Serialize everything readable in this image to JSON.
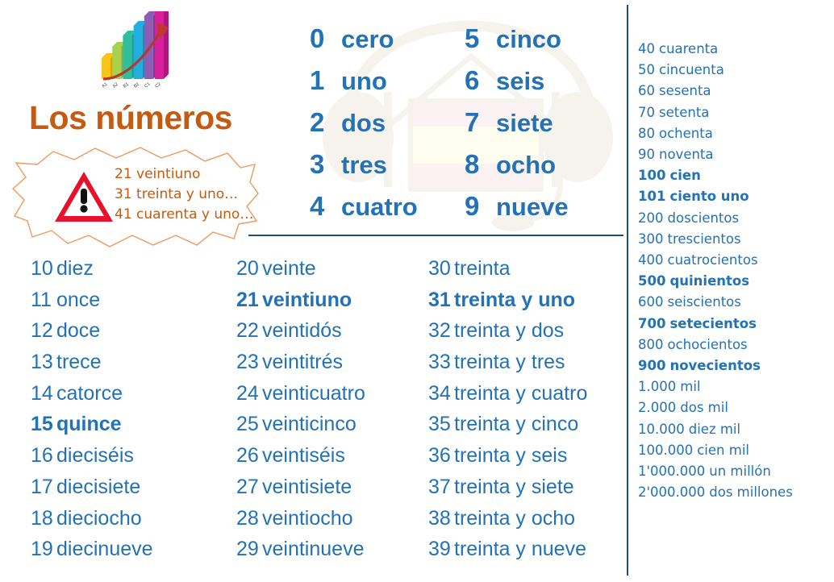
{
  "title": "Los números",
  "colors": {
    "blue": "#2272B5",
    "orange": "#C55A11",
    "navy": "#1F4E79",
    "warning_red": "#E8112D",
    "flag_red": "#FADBD8",
    "flag_yellow": "#FCFBDC"
  },
  "logo": {
    "name": "growth-bar-chart-logo",
    "bars": [
      {
        "color": "#F5C518",
        "side": "#D9A800",
        "height": 26,
        "label": "A1"
      },
      {
        "color": "#A8D14F",
        "side": "#87B030",
        "height": 40,
        "label": "A2"
      },
      {
        "color": "#2FBFA0",
        "side": "#1E9C81",
        "height": 54,
        "label": "B1"
      },
      {
        "color": "#22AEE0",
        "side": "#1A8CB5",
        "height": 66,
        "label": "B2"
      },
      {
        "color": "#8E5BB5",
        "side": "#6F4192",
        "height": 78,
        "label": "C1"
      },
      {
        "color": "#D6219B",
        "side": "#AF1680",
        "height": 92,
        "label": "C2"
      }
    ],
    "arrow_color": "#C0392B"
  },
  "callout": {
    "icon": "warning-triangle-icon",
    "lines": [
      "21 veintiuno",
      "31 treinta y uno…",
      "41 cuarenta y uno…"
    ]
  },
  "watermark": {
    "name": "headset-spanish-flag-watermark",
    "headset_color": "#E0D5C2",
    "flag_red": "#F8D7DA",
    "flag_yellow": "#FCFBD0"
  },
  "digits": {
    "left": [
      {
        "num": "0",
        "word": "cero"
      },
      {
        "num": "1",
        "word": "uno"
      },
      {
        "num": "2",
        "word": "dos"
      },
      {
        "num": "3",
        "word": "tres"
      },
      {
        "num": "4",
        "word": "cuatro"
      }
    ],
    "right": [
      {
        "num": "5",
        "word": "cinco"
      },
      {
        "num": "6",
        "word": "seis"
      },
      {
        "num": "7",
        "word": "siete"
      },
      {
        "num": "8",
        "word": "ocho"
      },
      {
        "num": "9",
        "word": "nueve"
      }
    ]
  },
  "teens": {
    "col0": [
      {
        "num": "10",
        "word": "diez",
        "bold": false
      },
      {
        "num": "11",
        "word": "once",
        "bold": false
      },
      {
        "num": "12",
        "word": "doce",
        "bold": false
      },
      {
        "num": "13",
        "word": "trece",
        "bold": false
      },
      {
        "num": "14",
        "word": "catorce",
        "bold": false
      },
      {
        "num": "15",
        "word": "quince",
        "bold": true
      },
      {
        "num": "16",
        "word": "dieciséis",
        "bold": false
      },
      {
        "num": "17",
        "word": "diecisiete",
        "bold": false
      },
      {
        "num": "18",
        "word": "dieciocho",
        "bold": false
      },
      {
        "num": "19",
        "word": "diecinueve",
        "bold": false
      }
    ],
    "col1": [
      {
        "num": "20",
        "word": "veinte",
        "bold": false
      },
      {
        "num": "21",
        "word": "veintiuno",
        "bold": true
      },
      {
        "num": "22",
        "word": "veintidós",
        "bold": false
      },
      {
        "num": "23",
        "word": "veintitrés",
        "bold": false
      },
      {
        "num": "24",
        "word": "veinticuatro",
        "bold": false
      },
      {
        "num": "25",
        "word": "veinticinco",
        "bold": false
      },
      {
        "num": "26",
        "word": "veintiséis",
        "bold": false
      },
      {
        "num": "27",
        "word": "veintisiete",
        "bold": false
      },
      {
        "num": "28",
        "word": "veintiocho",
        "bold": false
      },
      {
        "num": "29",
        "word": "veintinueve",
        "bold": false
      }
    ],
    "col2": [
      {
        "num": "30",
        "word": "treinta",
        "bold": false
      },
      {
        "num": "31",
        "word": "treinta y uno",
        "bold": true
      },
      {
        "num": "32",
        "word": "treinta y dos",
        "bold": false
      },
      {
        "num": "33",
        "word": "treinta y tres",
        "bold": false
      },
      {
        "num": "34",
        "word": "treinta y cuatro",
        "bold": false
      },
      {
        "num": "35",
        "word": "treinta y cinco",
        "bold": false
      },
      {
        "num": "36",
        "word": "treinta y seis",
        "bold": false
      },
      {
        "num": "37",
        "word": "treinta y siete",
        "bold": false
      },
      {
        "num": "38",
        "word": "treinta y ocho",
        "bold": false
      },
      {
        "num": "39",
        "word": "treinta y nueve",
        "bold": false
      }
    ]
  },
  "right_column": [
    {
      "num": "40",
      "word": "cuarenta",
      "bold": false
    },
    {
      "num": "50",
      "word": "cincuenta",
      "bold": false
    },
    {
      "num": "60",
      "word": "sesenta",
      "bold": false
    },
    {
      "num": "70",
      "word": "setenta",
      "bold": false
    },
    {
      "num": "80",
      "word": "ochenta",
      "bold": false
    },
    {
      "num": "90",
      "word": "noventa",
      "bold": false
    },
    {
      "num": "100",
      "word": "cien",
      "bold": true
    },
    {
      "num": "101",
      "word": "ciento uno",
      "bold": true
    },
    {
      "num": "200",
      "word": "doscientos",
      "bold": false
    },
    {
      "num": "300",
      "word": "trescientos",
      "bold": false
    },
    {
      "num": "400",
      "word": "cuatrocientos",
      "bold": false
    },
    {
      "num": "500",
      "word": "quinientos",
      "bold": true
    },
    {
      "num": "600",
      "word": "seiscientos",
      "bold": false
    },
    {
      "num": "700",
      "word": "setecientos",
      "bold": true
    },
    {
      "num": "800",
      "word": "ochocientos",
      "bold": false
    },
    {
      "num": "900",
      "word": "novecientos",
      "bold": true
    },
    {
      "num": "1.000",
      "word": "mil",
      "bold": false
    },
    {
      "num": "2.000",
      "word": "dos mil",
      "bold": false
    },
    {
      "num": "10.000",
      "word": "diez mil",
      "bold": false
    },
    {
      "num": "100.000",
      "word": "cien mil",
      "bold": false
    },
    {
      "num": "1'000.000",
      "word": "un millón",
      "bold": false
    },
    {
      "num": "2'000.000",
      "word": "dos millones",
      "bold": false
    }
  ]
}
